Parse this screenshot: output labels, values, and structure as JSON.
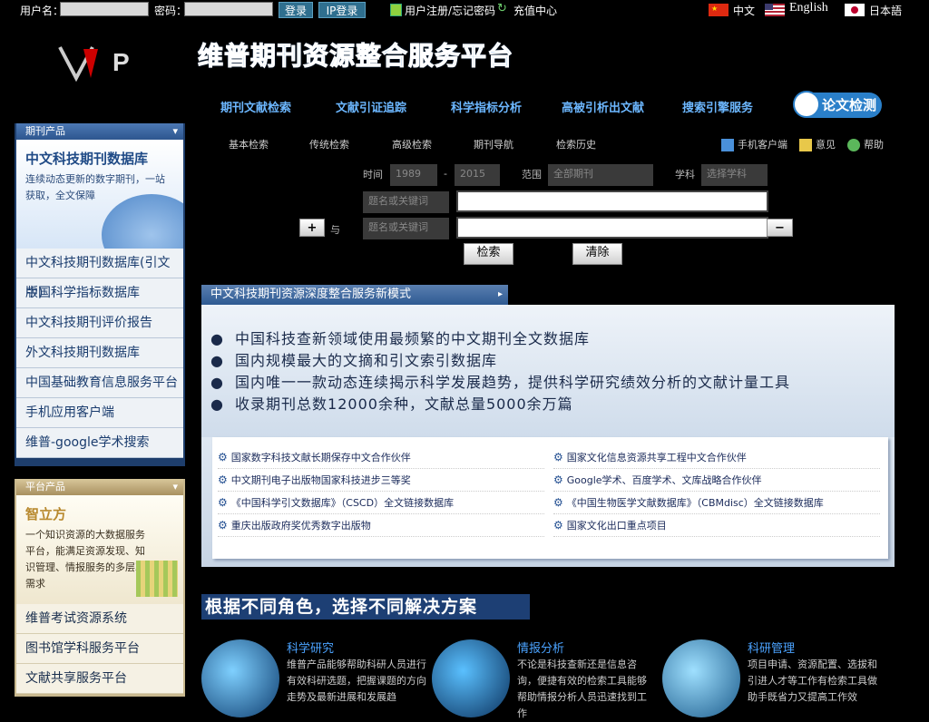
{
  "topbar": {
    "username_label": "用户名：",
    "password_label": "密码：",
    "login_btn": "登录",
    "ip_login_btn": "IP登录",
    "register_link": "用户注册/忘记密码",
    "recharge_link": "充值中心",
    "lang_zh": "中文",
    "lang_en": "English",
    "lang_ja": "日本語"
  },
  "header": {
    "site_title": "维普期刊资源整合服务平台"
  },
  "mainnav": [
    "期刊文献检索",
    "文献引证追踪",
    "科学指标分析",
    "高被引析出文献",
    "搜索引擎服务"
  ],
  "lunwen_label": "论文检测",
  "subnav": [
    "基本检索",
    "传统检索",
    "高级检索",
    "期刊导航",
    "检索历史"
  ],
  "utils": {
    "mobile": "手机客户端",
    "feedback": "意见",
    "help": "帮助"
  },
  "search": {
    "time_label": "时间",
    "year_from": "1989",
    "year_to": "2015",
    "dash": "-",
    "range_label": "范围",
    "range_value": "全部期刊",
    "subject_label": "学科",
    "subject_value": "选择学科",
    "field1": "题名或关键词",
    "field2": "题名或关键词",
    "and_label": "与",
    "plus": "+",
    "minus": "−",
    "search_btn": "检索",
    "clear_btn": "清除"
  },
  "sidebar1": {
    "head": "期刊产品",
    "feat_title": "中文科技期刊数据库",
    "feat_desc": "连续动态更新的数字期刊，一站获取，全文保障",
    "items": [
      "中文科技期刊数据库(引文版)",
      "中国科学指标数据库",
      "中文科技期刊评价报告",
      "外文科技期刊数据库",
      "中国基础教育信息服务平台",
      "手机应用客户端",
      "维普-google学术搜索"
    ]
  },
  "sidebar2": {
    "head": "平台产品",
    "feat_title": "智立方",
    "feat_desc": "一个知识资源的大数据服务平台，能满足资源发现、知识管理、情报服务的多层次需求",
    "items": [
      "维普考试资源系统",
      "图书馆学科服务平台",
      "文献共享服务平台"
    ]
  },
  "banner": {
    "tab": "中文科技期刊资源深度整合服务新模式",
    "bullets": [
      "中国科技查新领域使用最频繁的中文期刊全文数据库",
      "国内规模最大的文摘和引文索引数据库",
      "国内唯一一款动态连续揭示科学发展趋势，提供科学研究绩效分析的文献计量工具",
      "收录期刊总数12000余种，文献总量5000余万篇"
    ]
  },
  "partners": {
    "left": [
      "国家数字科技文献长期保存中文合作伙伴",
      "中文期刊电子出版物国家科技进步三等奖",
      "《中国科学引文数据库》（CSCD）全文链接数据库",
      "重庆出版政府奖优秀数字出版物"
    ],
    "right": [
      "国家文化信息资源共享工程中文合作伙伴",
      "Google学术、百度学术、文库战略合作伙伴",
      "《中国生物医学文献数据库》（CBMdisc）全文链接数据库",
      "国家文化出口重点项目"
    ]
  },
  "roles": {
    "title": "根据不同角色，选择不同解决方案",
    "items": [
      {
        "h": "科学研究",
        "t": "维普产品能够帮助科研人员进行有效科研选题，把握课题的方向走势及最新进展和发展趋"
      },
      {
        "h": "情报分析",
        "t": "不论是科技查新还是信息咨询，便捷有效的检索工具能够帮助情报分析人员迅速找到工作"
      },
      {
        "h": "科研管理",
        "t": "项目申请、资源配置、选拔和引进人才等工作有检索工具做助手既省力又提高工作效"
      }
    ]
  }
}
